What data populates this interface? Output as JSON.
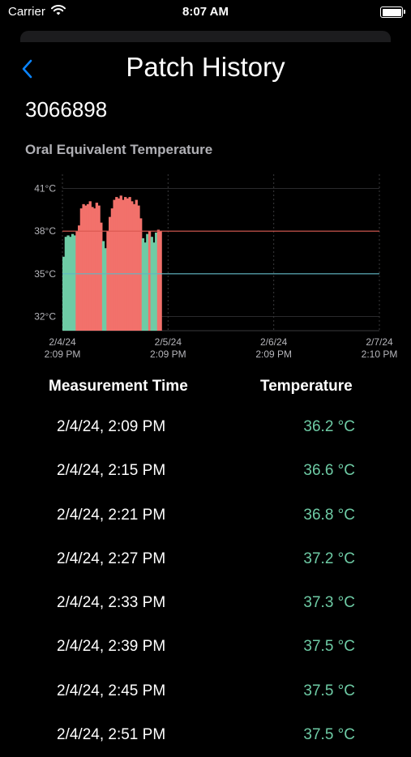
{
  "status_bar": {
    "carrier": "Carrier",
    "time": "8:07 AM"
  },
  "header": {
    "title": "Patch History",
    "back_icon": "chevron-left-icon"
  },
  "patch_id": "3066898",
  "chart_title": "Oral Equivalent Temperature",
  "colors": {
    "accent": "#0a84ff",
    "normal": "#6ecba5",
    "fever": "#f2716b",
    "fever_line": "#d9594f",
    "low_line": "#5fb7c4"
  },
  "chart_data": {
    "type": "area",
    "title": "Oral Equivalent Temperature",
    "ylabel": "",
    "xlabel": "",
    "y_ticks": [
      "41°C",
      "38°C",
      "35°C",
      "32°C"
    ],
    "y_tick_values": [
      41,
      38,
      35,
      32
    ],
    "ylim": [
      31,
      42
    ],
    "x_ticks": [
      {
        "date": "2/4/24",
        "time": "2:09 PM",
        "hours": 0
      },
      {
        "date": "2/5/24",
        "time": "2:09 PM",
        "hours": 24
      },
      {
        "date": "2/6/24",
        "time": "2:09 PM",
        "hours": 48
      },
      {
        "date": "2/7/24",
        "time": "2:10 PM",
        "hours": 72
      }
    ],
    "thresholds": [
      {
        "value": 38,
        "color": "#d9594f"
      },
      {
        "value": 35,
        "color": "#5fb7c4"
      }
    ],
    "series_hours": [
      0,
      0.5,
      1,
      1.5,
      2,
      2.5,
      3,
      3.5,
      4,
      4.5,
      5,
      5.5,
      6,
      6.5,
      7,
      7.5,
      8,
      8.5,
      9,
      9.5,
      10,
      10.5,
      11,
      11.5,
      12,
      12.5,
      13,
      13.5,
      14,
      14.5,
      15,
      15.5,
      16,
      16.5,
      17,
      17.5,
      18,
      18.5,
      19,
      19.5,
      20,
      20.5,
      21,
      21.5,
      22
    ],
    "series_values": [
      36.2,
      37.6,
      37.7,
      37.6,
      37.8,
      37.7,
      38.0,
      38.4,
      39.6,
      39.9,
      39.8,
      39.9,
      40.1,
      39.7,
      39.6,
      40.0,
      39.8,
      38.6,
      37.3,
      36.8,
      38.0,
      39.0,
      39.6,
      40.2,
      40.4,
      40.3,
      40.5,
      40.2,
      40.4,
      40.3,
      40.4,
      40.1,
      39.9,
      40.2,
      39.8,
      38.9,
      37.5,
      37.2,
      37.8,
      38.0,
      37.6,
      37.2,
      37.9,
      38.1,
      38.0
    ]
  },
  "table": {
    "headers": {
      "time": "Measurement Time",
      "temperature": "Temperature"
    },
    "rows": [
      {
        "time": "2/4/24, 2:09 PM",
        "temp": "36.2 °C"
      },
      {
        "time": "2/4/24, 2:15 PM",
        "temp": "36.6 °C"
      },
      {
        "time": "2/4/24, 2:21 PM",
        "temp": "36.8 °C"
      },
      {
        "time": "2/4/24, 2:27 PM",
        "temp": "37.2 °C"
      },
      {
        "time": "2/4/24, 2:33 PM",
        "temp": "37.3 °C"
      },
      {
        "time": "2/4/24, 2:39 PM",
        "temp": "37.5 °C"
      },
      {
        "time": "2/4/24, 2:45 PM",
        "temp": "37.5 °C"
      },
      {
        "time": "2/4/24, 2:51 PM",
        "temp": "37.5 °C"
      }
    ]
  }
}
